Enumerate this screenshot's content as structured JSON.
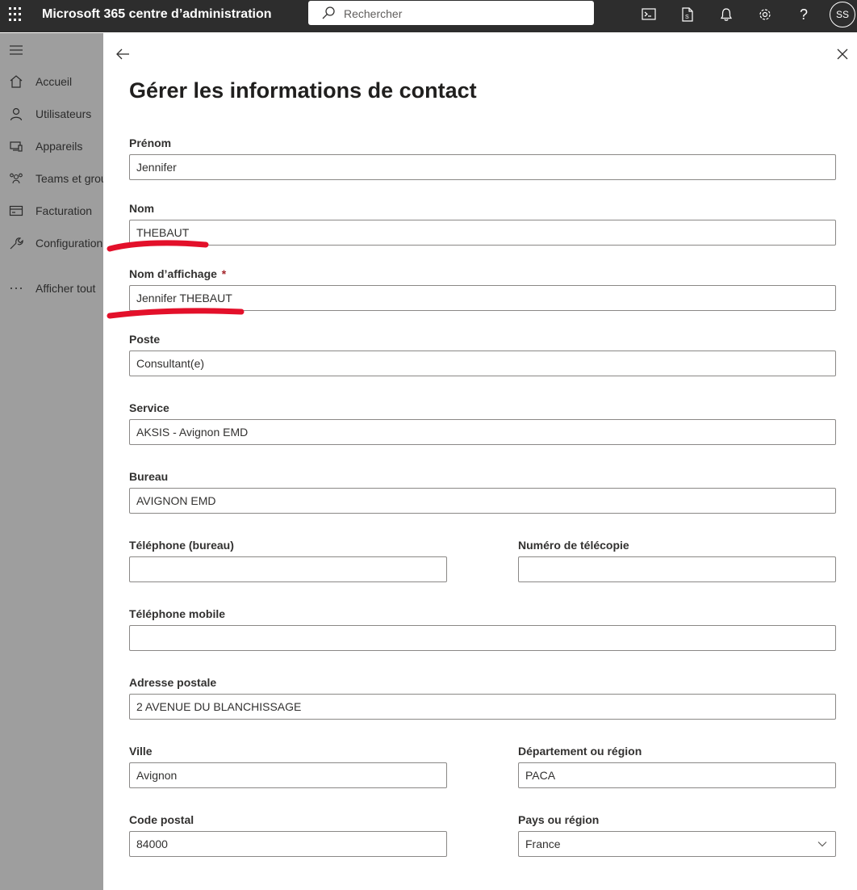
{
  "topbar": {
    "title": "Microsoft 365 centre d’administration",
    "search_placeholder": "Rechercher",
    "avatar_initials": "SS"
  },
  "nav": {
    "items": [
      {
        "label": "Accueil",
        "icon": "home-icon"
      },
      {
        "label": "Utilisateurs",
        "icon": "person-icon"
      },
      {
        "label": "Appareils",
        "icon": "devices-icon"
      },
      {
        "label": "Teams et groupes",
        "icon": "teams-icon"
      },
      {
        "label": "Facturation",
        "icon": "billing-icon"
      },
      {
        "label": "Configuration",
        "icon": "wrench-icon"
      },
      {
        "label": "Afficher tout",
        "icon": "more-icon"
      }
    ]
  },
  "panel": {
    "title": "Gérer les informations de contact",
    "fields": {
      "prenom": {
        "label": "Prénom",
        "value": "Jennifer"
      },
      "nom": {
        "label": "Nom",
        "value": "THEBAUT"
      },
      "nom_affichage": {
        "label": "Nom d’affichage",
        "required_mark": "*",
        "value": "Jennifer THEBAUT"
      },
      "poste": {
        "label": "Poste",
        "value": "Consultant(e)"
      },
      "service": {
        "label": "Service",
        "value": "AKSIS - Avignon EMD"
      },
      "bureau": {
        "label": "Bureau",
        "value": "AVIGNON EMD"
      },
      "tel_bureau": {
        "label": "Téléphone (bureau)",
        "value": ""
      },
      "telecopie": {
        "label": "Numéro de télécopie",
        "value": ""
      },
      "tel_mobile": {
        "label": "Téléphone mobile",
        "value": ""
      },
      "adresse": {
        "label": "Adresse postale",
        "value": "2 AVENUE DU BLANCHISSAGE"
      },
      "ville": {
        "label": "Ville",
        "value": "Avignon"
      },
      "departement": {
        "label": "Département ou région",
        "value": "PACA"
      },
      "code_postal": {
        "label": "Code postal",
        "value": "84000"
      },
      "pays": {
        "label": "Pays ou région",
        "value": "France"
      }
    }
  },
  "colors": {
    "topbar": "#2d2d2d",
    "annotation": "#e3102a",
    "required": "#a4262c"
  }
}
